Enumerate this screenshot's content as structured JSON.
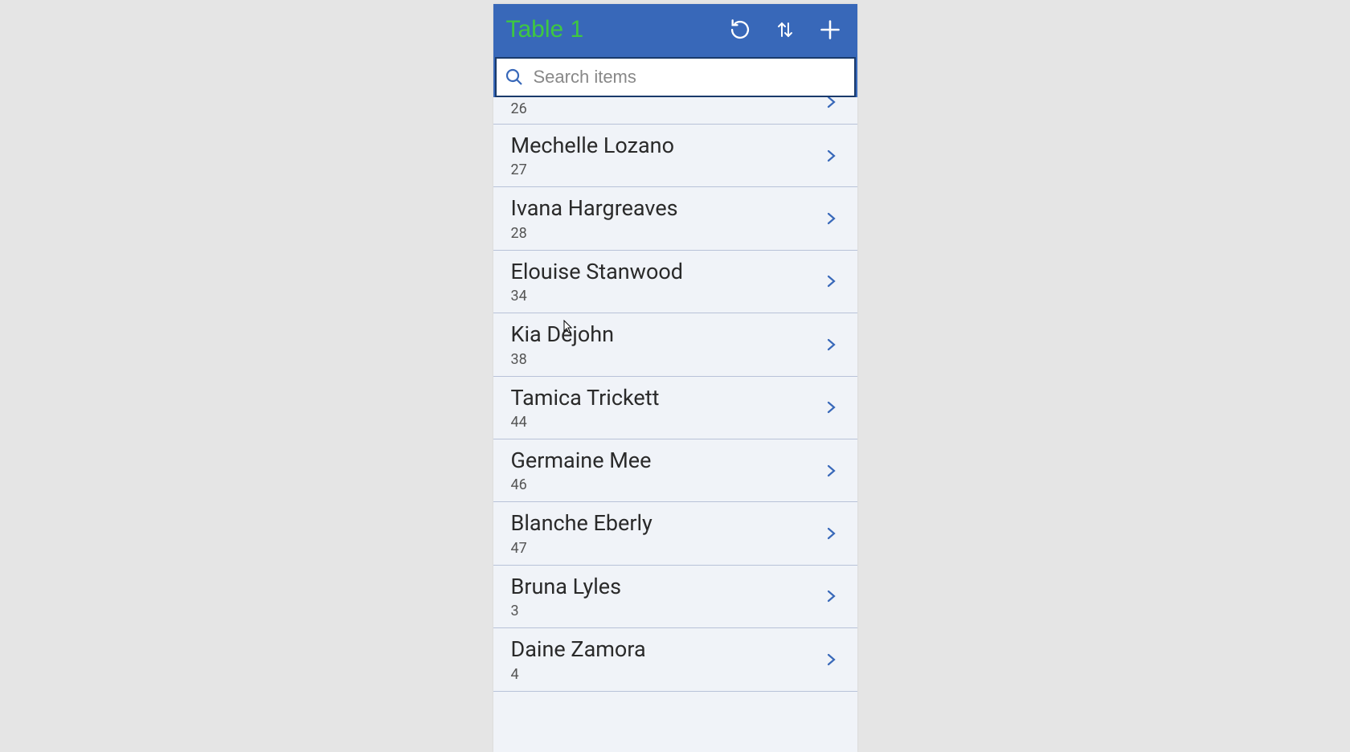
{
  "header": {
    "title": "Table 1"
  },
  "search": {
    "placeholder": "Search items",
    "value": ""
  },
  "partial": {
    "sub": "26"
  },
  "items": [
    {
      "name": "Mechelle Lozano",
      "sub": "27"
    },
    {
      "name": "Ivana Hargreaves",
      "sub": "28"
    },
    {
      "name": "Elouise Stanwood",
      "sub": "34"
    },
    {
      "name": "Kia Dejohn",
      "sub": "38"
    },
    {
      "name": "Tamica Trickett",
      "sub": "44"
    },
    {
      "name": "Germaine Mee",
      "sub": "46"
    },
    {
      "name": "Blanche Eberly",
      "sub": "47"
    },
    {
      "name": "Bruna Lyles",
      "sub": "3"
    },
    {
      "name": "Daine Zamora",
      "sub": "4"
    }
  ]
}
